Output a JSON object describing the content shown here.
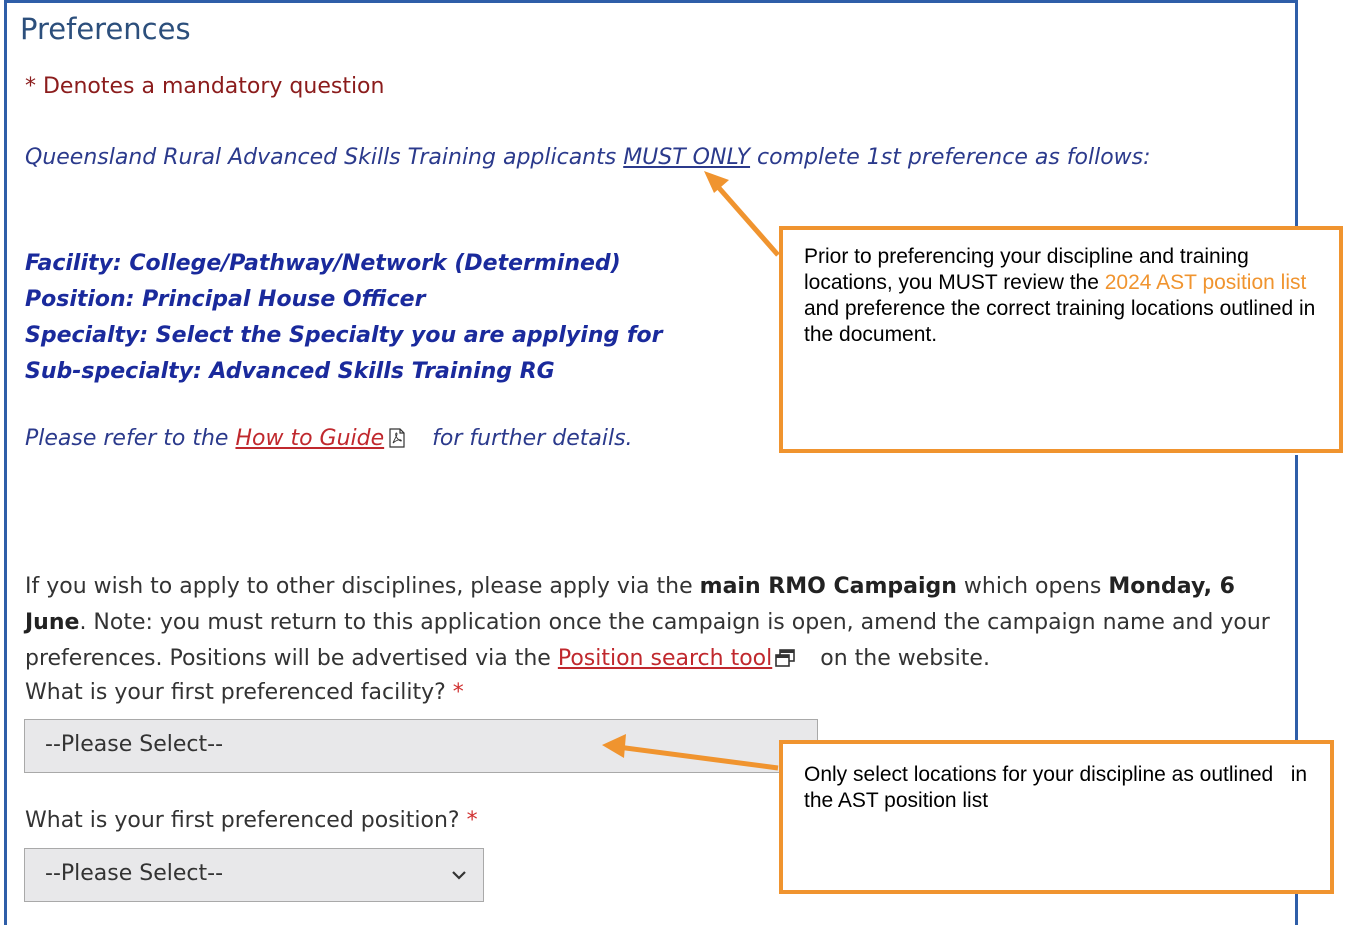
{
  "section_title": "Preferences",
  "mandatory_note": "* Denotes a mandatory question",
  "intro": {
    "part1": "Queensland Rural Advanced Skills Training applicants ",
    "emphasis": "MUST ONLY",
    "part2": " complete 1st preference as follows:"
  },
  "requirements": [
    "Facility: College/Pathway/Network (Determined)",
    "Position: Principal House Officer",
    "Specialty: Select the Specialty you are applying for",
    "Sub-specialty: Advanced Skills Training RG"
  ],
  "refer": {
    "before": "Please refer to the ",
    "link": "How to Guide",
    "after": "for further details."
  },
  "other_disciplines": {
    "t1": "If you wish to apply to other disciplines, please apply via the ",
    "b1": "main RMO Campaign",
    "t2": " which opens ",
    "b2": "Monday, 6 June",
    "t3": ". Note: you must return to this application once the campaign is open, amend the campaign name and your preferences. Positions will be advertised via the ",
    "link": "Position search tool",
    "t4": "on the website."
  },
  "questions": {
    "facility": {
      "label": "What is your first preferenced facility?",
      "required": "*",
      "value": "--Please Select--"
    },
    "position": {
      "label": "What is your first preferenced position?",
      "required": "*",
      "value": "--Please Select--"
    }
  },
  "callouts": {
    "review": {
      "t1": "Prior to preferencing your discipline and training locations, you MUST review the ",
      "highlight": "2024 AST position list",
      "t2": " and preference the correct training locations outlined in the document."
    },
    "locations": "Only select locations for your discipline as outlined   in the AST position list"
  },
  "colors": {
    "callout_border": "#f0942f",
    "frame": "#2f5ea8",
    "link": "#c0282d",
    "heading": "#2c4f7c"
  },
  "icons": [
    "pdf-icon",
    "new-window-icon",
    "chevron-down-icon"
  ]
}
